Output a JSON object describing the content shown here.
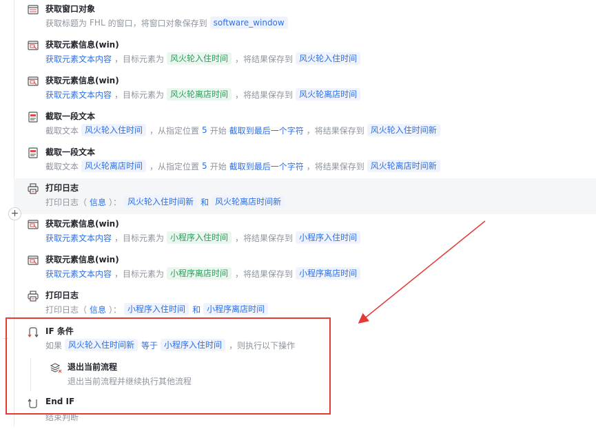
{
  "steps": [
    {
      "title": "获取窗口对象",
      "icon": "window-icon",
      "desc": [
        {
          "k": "t",
          "v": "获取标题为"
        },
        {
          "k": "t",
          "v": "FHL"
        },
        {
          "k": "t",
          "v": "的窗口，将窗口对象保存到"
        },
        {
          "k": "var",
          "v": "software_window"
        }
      ]
    },
    {
      "title": "获取元素信息(win)",
      "icon": "element-info-icon",
      "desc": [
        {
          "k": "link",
          "v": "获取元素文本内容"
        },
        {
          "k": "t",
          "v": "，目标元素为"
        },
        {
          "k": "elem",
          "v": "风火轮入住时间"
        },
        {
          "k": "t",
          "v": "，将结果保存到"
        },
        {
          "k": "var",
          "v": "风火轮入住时间"
        }
      ]
    },
    {
      "title": "获取元素信息(win)",
      "icon": "element-info-icon",
      "desc": [
        {
          "k": "link",
          "v": "获取元素文本内容"
        },
        {
          "k": "t",
          "v": "，目标元素为"
        },
        {
          "k": "elem",
          "v": "风火轮离店时间"
        },
        {
          "k": "t",
          "v": "，将结果保存到"
        },
        {
          "k": "var",
          "v": "风火轮离店时间"
        }
      ]
    },
    {
      "title": "截取一段文本",
      "icon": "text-cut-icon",
      "desc": [
        {
          "k": "t",
          "v": "截取文本"
        },
        {
          "k": "var",
          "v": "风火轮入住时间"
        },
        {
          "k": "t",
          "v": "，从指定位置"
        },
        {
          "k": "link",
          "v": "5"
        },
        {
          "k": "t",
          "v": "开始"
        },
        {
          "k": "link",
          "v": "截取到最后一个字符"
        },
        {
          "k": "t",
          "v": "，将结果保存到"
        },
        {
          "k": "var",
          "v": "风火轮入住时间新"
        }
      ]
    },
    {
      "title": "截取一段文本",
      "icon": "text-cut-icon",
      "desc": [
        {
          "k": "t",
          "v": "截取文本"
        },
        {
          "k": "var",
          "v": "风火轮离店时间"
        },
        {
          "k": "t",
          "v": "，从指定位置"
        },
        {
          "k": "link",
          "v": "5"
        },
        {
          "k": "t",
          "v": "开始"
        },
        {
          "k": "link",
          "v": "截取到最后一个字符"
        },
        {
          "k": "t",
          "v": "，将结果保存到"
        },
        {
          "k": "var",
          "v": "风火轮离店时间新"
        }
      ]
    },
    {
      "title": "打印日志",
      "icon": "print-log-icon",
      "active": true,
      "desc": [
        {
          "k": "t",
          "v": "打印日志（"
        },
        {
          "k": "link",
          "v": "信息"
        },
        {
          "k": "t",
          "v": "）："
        },
        {
          "k": "var",
          "v": "风火轮入住时间新"
        },
        {
          "k": "link",
          "v": "和"
        },
        {
          "k": "var",
          "v": "风火轮离店时间新"
        }
      ]
    },
    {
      "title": "获取元素信息(win)",
      "icon": "element-info-icon",
      "desc": [
        {
          "k": "link",
          "v": "获取元素文本内容"
        },
        {
          "k": "t",
          "v": "，目标元素为"
        },
        {
          "k": "elem",
          "v": "小程序入住时间"
        },
        {
          "k": "t",
          "v": "，将结果保存到"
        },
        {
          "k": "var",
          "v": "小程序入住时间"
        }
      ]
    },
    {
      "title": "获取元素信息(win)",
      "icon": "element-info-icon",
      "desc": [
        {
          "k": "link",
          "v": "获取元素文本内容"
        },
        {
          "k": "t",
          "v": "，目标元素为"
        },
        {
          "k": "elem",
          "v": "小程序离店时间"
        },
        {
          "k": "t",
          "v": "，将结果保存到"
        },
        {
          "k": "var",
          "v": "小程序离店时间"
        }
      ]
    },
    {
      "title": "打印日志",
      "icon": "print-log-icon",
      "desc": [
        {
          "k": "t",
          "v": "打印日志（"
        },
        {
          "k": "link",
          "v": "信息"
        },
        {
          "k": "t",
          "v": "）："
        },
        {
          "k": "var",
          "v": "小程序入住时间"
        },
        {
          "k": "link",
          "v": "和"
        },
        {
          "k": "var",
          "v": "小程序离店时间"
        }
      ]
    },
    {
      "title": "IF 条件",
      "icon": "if-branch-icon",
      "desc": [
        {
          "k": "t",
          "v": "如果"
        },
        {
          "k": "var",
          "v": "风火轮入住时间新"
        },
        {
          "k": "link",
          "v": "等于"
        },
        {
          "k": "var",
          "v": "小程序入住时间"
        },
        {
          "k": "t",
          "v": "，则执行以下操作"
        }
      ]
    },
    {
      "title": "退出当前流程",
      "icon": "exit-flow-icon",
      "nested": true,
      "desc": [
        {
          "k": "t",
          "v": "退出当前流程并继续执行其他流程"
        }
      ]
    },
    {
      "title": "End IF",
      "icon": "end-if-icon",
      "desc": [
        {
          "k": "t",
          "v": "结束判断"
        }
      ]
    }
  ],
  "add_button": "+",
  "colors": {
    "highlight_box": "#e53935",
    "arrow": "#e53935",
    "link": "#2f6fe6",
    "element_chip": "#2c9b5b"
  }
}
